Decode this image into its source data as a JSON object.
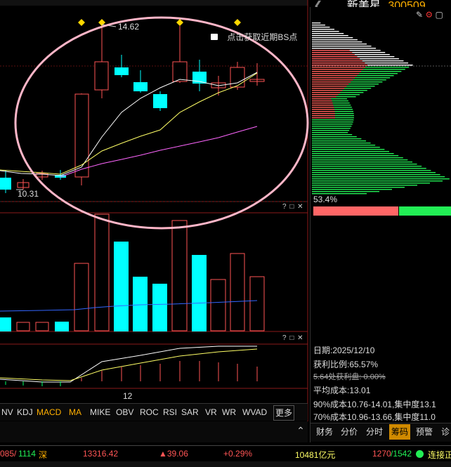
{
  "stock": {
    "name": "新美星",
    "code": "300509"
  },
  "main_chart": {
    "high_label": "14.62",
    "low_label": "10.31",
    "bs_hint": "点击获取近期BS点"
  },
  "date_tick": "12",
  "panel_icons": {
    "help": "?",
    "maximize": "□",
    "close": "✕"
  },
  "indicator_tabs": [
    {
      "label": "NV"
    },
    {
      "label": "KDJ"
    },
    {
      "label": "MACD"
    },
    {
      "label": "MA"
    },
    {
      "label": "MIKE"
    },
    {
      "label": "OBV"
    },
    {
      "label": "ROC"
    },
    {
      "label": "RSI"
    },
    {
      "label": "SAR"
    },
    {
      "label": "VR"
    },
    {
      "label": "WR"
    },
    {
      "label": "WVAD"
    },
    {
      "label": "更多"
    }
  ],
  "chip": {
    "profit_pct": "53.4%",
    "date": "日期:2025/12/10",
    "profit_ratio": "获利比例:65.57%",
    "cost_line": "5.64处获利盘: 0.00%",
    "avg_cost": "平均成本:13.01",
    "c90": "90%成本10.76-14.01,集中度13.1",
    "c70": "70%成本10.96-13.66,集中度11.0"
  },
  "right_tabs": [
    {
      "label": "财务"
    },
    {
      "label": "分价"
    },
    {
      "label": "分时"
    },
    {
      "label": "筹码"
    },
    {
      "label": "预警"
    },
    {
      "label": "诊"
    }
  ],
  "status_bar": {
    "left_count": "085/",
    "left_count2": "1114",
    "market": "深",
    "index": "13316.42",
    "change": "▲39.06",
    "change_pct": "+0.29%",
    "turnover": "10481亿元",
    "adv": "1270",
    "dec": "/1542",
    "connect": "连接正"
  },
  "colors": {
    "up": "#ff5555",
    "down": "#00ffff",
    "ma5": "#ffffff",
    "ma10": "#ffff66",
    "ma20": "#ff66ff",
    "vol_ma": "#3366ff",
    "circle": "#ffb6c8",
    "active_tab": "#ffb000"
  }
}
